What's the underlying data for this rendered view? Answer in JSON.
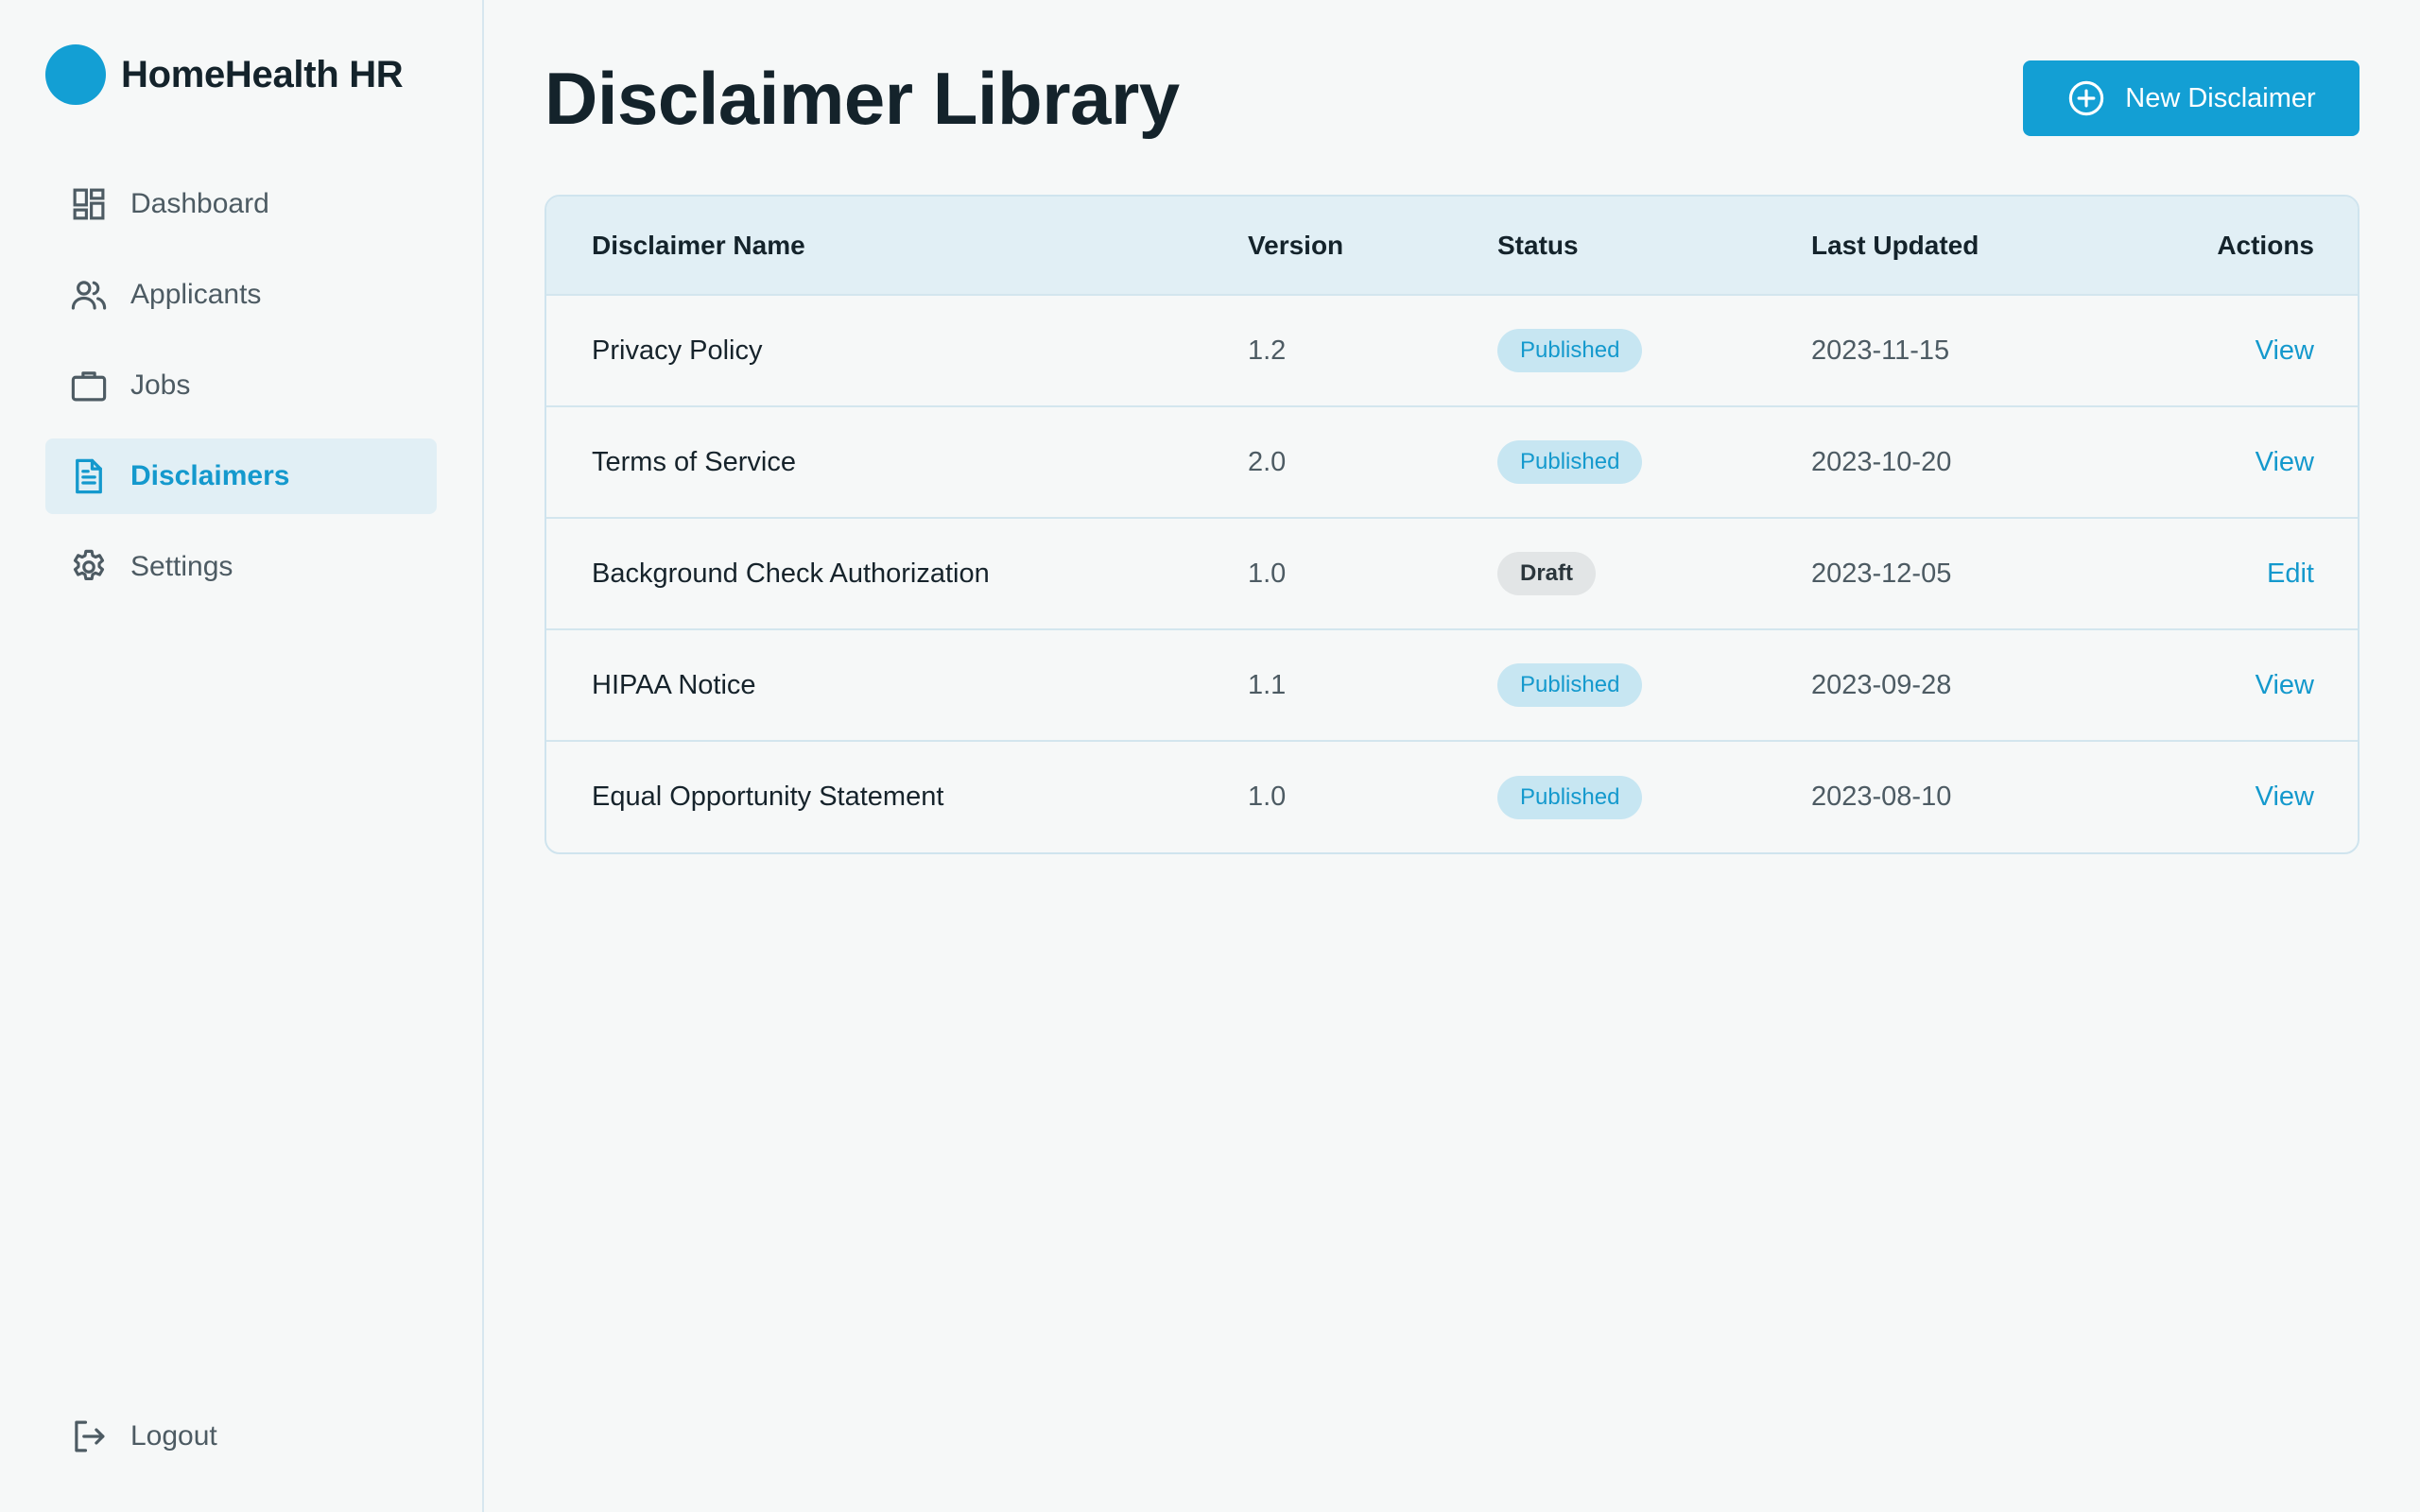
{
  "brand": {
    "name": "HomeHealth HR",
    "color": "#139fd4"
  },
  "sidebar": {
    "items": [
      {
        "label": "Dashboard",
        "icon": "dashboard-icon"
      },
      {
        "label": "Applicants",
        "icon": "users-icon"
      },
      {
        "label": "Jobs",
        "icon": "briefcase-icon"
      },
      {
        "label": "Disclaimers",
        "icon": "document-icon",
        "active": true
      },
      {
        "label": "Settings",
        "icon": "gear-icon"
      }
    ],
    "logout": {
      "label": "Logout",
      "icon": "logout-icon"
    }
  },
  "header": {
    "title": "Disclaimer Library",
    "new_button": {
      "label": "New Disclaimer",
      "icon": "plus-circle-icon"
    }
  },
  "table": {
    "columns": [
      "Disclaimer Name",
      "Version",
      "Status",
      "Last Updated",
      "Actions"
    ],
    "rows": [
      {
        "name": "Privacy Policy",
        "version": "1.2",
        "status": "Published",
        "updated": "2023-11-15",
        "action": "View"
      },
      {
        "name": "Terms of Service",
        "version": "2.0",
        "status": "Published",
        "updated": "2023-10-20",
        "action": "View"
      },
      {
        "name": "Background Check Authorization",
        "version": "1.0",
        "status": "Draft",
        "updated": "2023-12-05",
        "action": "Edit"
      },
      {
        "name": "HIPAA Notice",
        "version": "1.1",
        "status": "Published",
        "updated": "2023-09-28",
        "action": "View"
      },
      {
        "name": "Equal Opportunity Statement",
        "version": "1.0",
        "status": "Published",
        "updated": "2023-08-10",
        "action": "View"
      }
    ]
  },
  "colors": {
    "accent": "#139fd4",
    "published_badge_bg": "#c7e6f2",
    "draft_badge_bg": "#e2e5e6",
    "header_row_bg": "#e1eff5"
  }
}
